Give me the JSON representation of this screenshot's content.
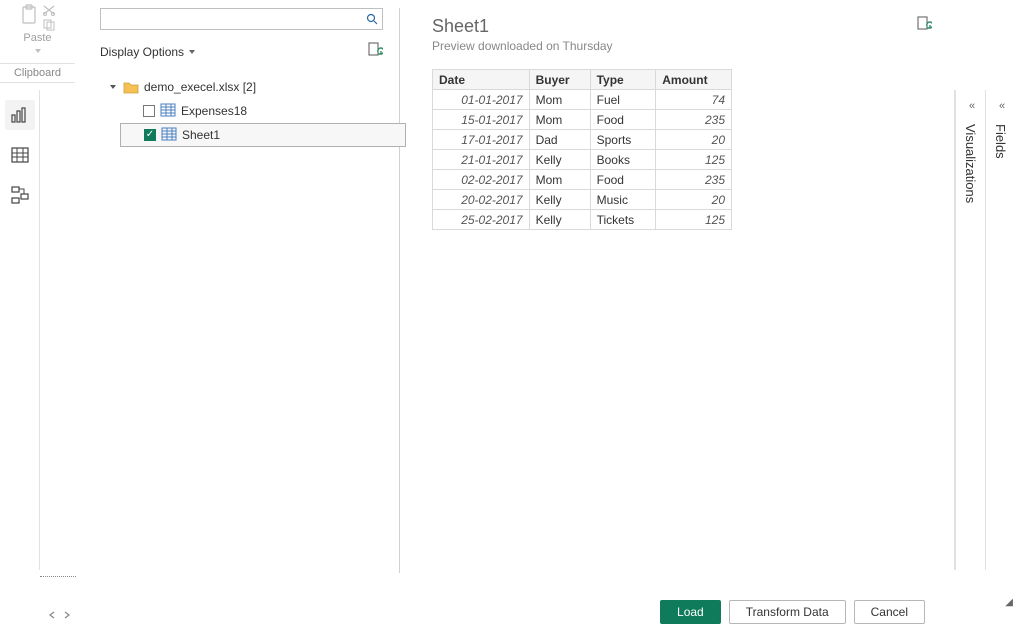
{
  "ribbon": {
    "paste_label": "Paste",
    "clipboard_label": "Clipboard"
  },
  "navigator": {
    "search_placeholder": "",
    "display_options_label": "Display Options",
    "root_label": "demo_execel.xlsx [2]",
    "items": [
      {
        "label": "Expenses18",
        "checked": false,
        "selected": false
      },
      {
        "label": "Sheet1",
        "checked": true,
        "selected": true
      }
    ]
  },
  "preview": {
    "title": "Sheet1",
    "subtitle": "Preview downloaded on Thursday",
    "columns": [
      "Date",
      "Buyer",
      "Type",
      "Amount"
    ],
    "rows": [
      {
        "date": "01-01-2017",
        "buyer": "Mom",
        "type": "Fuel",
        "amount": "74"
      },
      {
        "date": "15-01-2017",
        "buyer": "Mom",
        "type": "Food",
        "amount": "235"
      },
      {
        "date": "17-01-2017",
        "buyer": "Dad",
        "type": "Sports",
        "amount": "20"
      },
      {
        "date": "21-01-2017",
        "buyer": "Kelly",
        "type": "Books",
        "amount": "125"
      },
      {
        "date": "02-02-2017",
        "buyer": "Mom",
        "type": "Food",
        "amount": "235"
      },
      {
        "date": "20-02-2017",
        "buyer": "Kelly",
        "type": "Music",
        "amount": "20"
      },
      {
        "date": "25-02-2017",
        "buyer": "Kelly",
        "type": "Tickets",
        "amount": "125"
      }
    ]
  },
  "buttons": {
    "load": "Load",
    "transform": "Transform Data",
    "cancel": "Cancel"
  },
  "right_panes": {
    "visualizations": "Visualizations",
    "fields": "Fields"
  }
}
